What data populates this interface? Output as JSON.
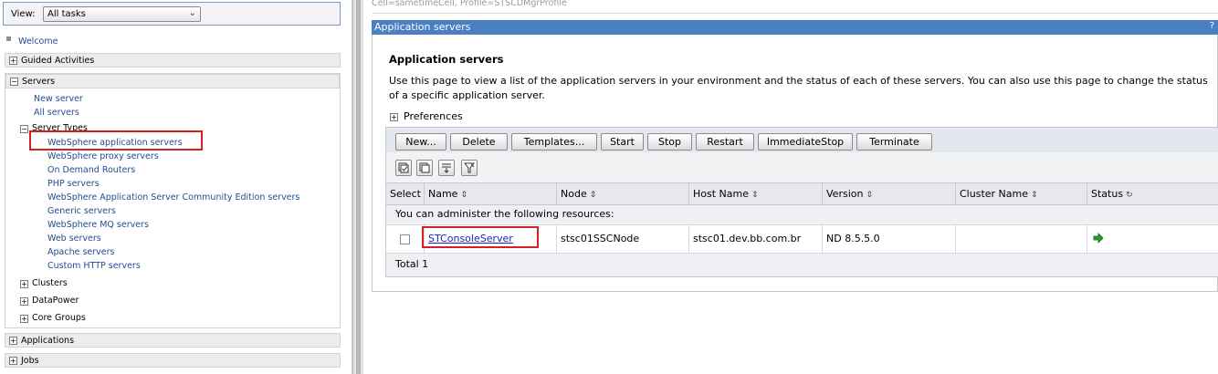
{
  "nav": {
    "view_label": "View:",
    "view_value": "All tasks",
    "welcome": "Welcome",
    "sections": {
      "guided": "Guided Activities",
      "servers": "Servers",
      "clusters": "Clusters",
      "datapower": "DataPower",
      "core_groups": "Core Groups",
      "applications": "Applications",
      "jobs": "Jobs"
    },
    "server_links": {
      "new_server": "New server",
      "all_servers": "All servers"
    },
    "server_types_label": "Server Types",
    "server_types": [
      "WebSphere application servers",
      "WebSphere proxy servers",
      "On Demand Routers",
      "PHP servers",
      "WebSphere Application Server Community Edition servers",
      "Generic servers",
      "WebSphere MQ servers",
      "Web servers",
      "Apache servers",
      "Custom HTTP servers"
    ]
  },
  "main": {
    "scope": "Cell=sametimeCell, Profile=STSCDMgrProfile",
    "portlet_title": "Application servers",
    "help": "?",
    "heading": "Application servers",
    "description": "Use this page to view a list of the application servers in your environment and the status of each of these servers. You can also use this page to change the status of a specific application server.",
    "preferences": "Preferences",
    "buttons": {
      "new": "New...",
      "delete": "Delete",
      "templates": "Templates...",
      "start": "Start",
      "stop": "Stop",
      "restart": "Restart",
      "immediate_stop": "ImmediateStop",
      "terminate": "Terminate"
    },
    "table": {
      "headers": {
        "select": "Select",
        "name": "Name",
        "node": "Node",
        "host": "Host Name",
        "version": "Version",
        "cluster": "Cluster Name",
        "status": "Status"
      },
      "admin_text": "You can administer the following resources:",
      "rows": [
        {
          "name": "STConsoleServer",
          "node": "stsc01SSCNode",
          "host": "stsc01.dev.bb.com.br",
          "version": "ND 8.5.5.0",
          "cluster": "",
          "status_icon": "started-arrow-icon"
        }
      ],
      "total": "Total 1"
    }
  },
  "colors": {
    "title_bar": "#4a7fc1",
    "link": "#1f4c8f",
    "highlight": "#d42020",
    "status_green": "#2a9a2a"
  }
}
